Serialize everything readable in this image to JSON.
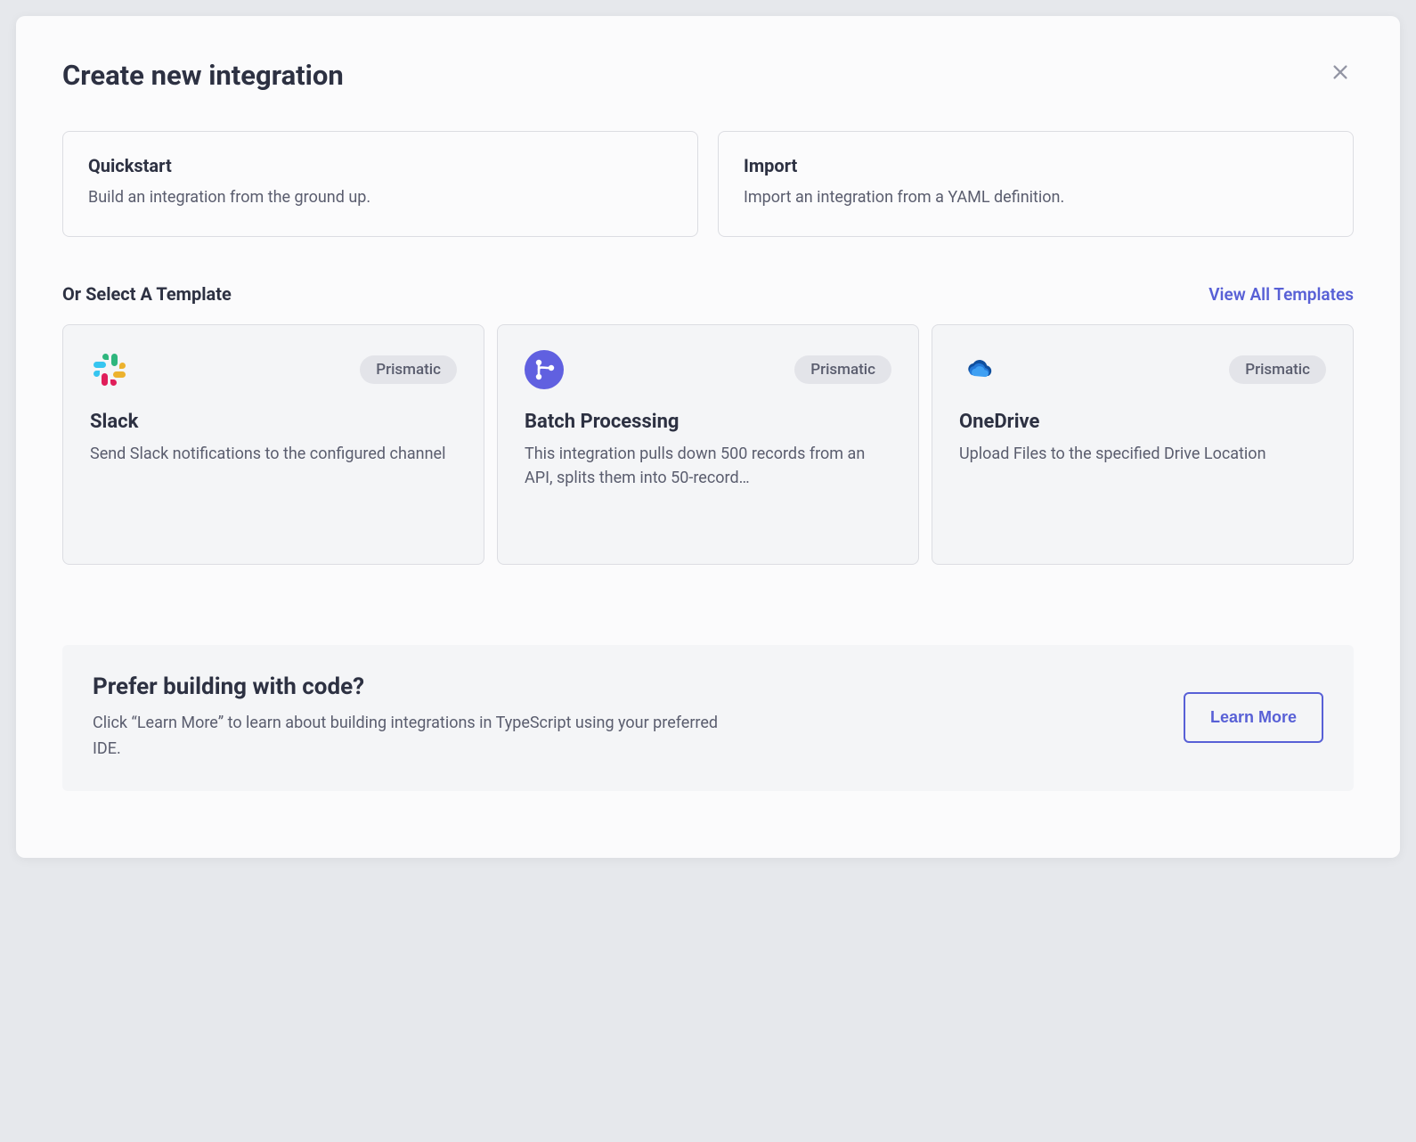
{
  "modal": {
    "title": "Create new integration"
  },
  "options": [
    {
      "title": "Quickstart",
      "desc": "Build an integration from the ground up."
    },
    {
      "title": "Import",
      "desc": "Import an integration from a YAML definition."
    }
  ],
  "templates": {
    "header": "Or Select A Template",
    "view_all": "View All Templates",
    "items": [
      {
        "name": "Slack",
        "badge": "Prismatic",
        "desc": "Send Slack notifications to the configured channel",
        "icon": "slack"
      },
      {
        "name": "Batch Processing",
        "badge": "Prismatic",
        "desc": "This integration pulls down 500 records from an API, splits them into 50-record…",
        "icon": "git"
      },
      {
        "name": "OneDrive",
        "badge": "Prismatic",
        "desc": "Upload Files to the specified Drive Location",
        "icon": "onedrive"
      }
    ]
  },
  "code_banner": {
    "title": "Prefer building with code?",
    "desc": "Click “Learn More” to learn about building integrations in TypeScript using your preferred IDE.",
    "button": "Learn More"
  }
}
